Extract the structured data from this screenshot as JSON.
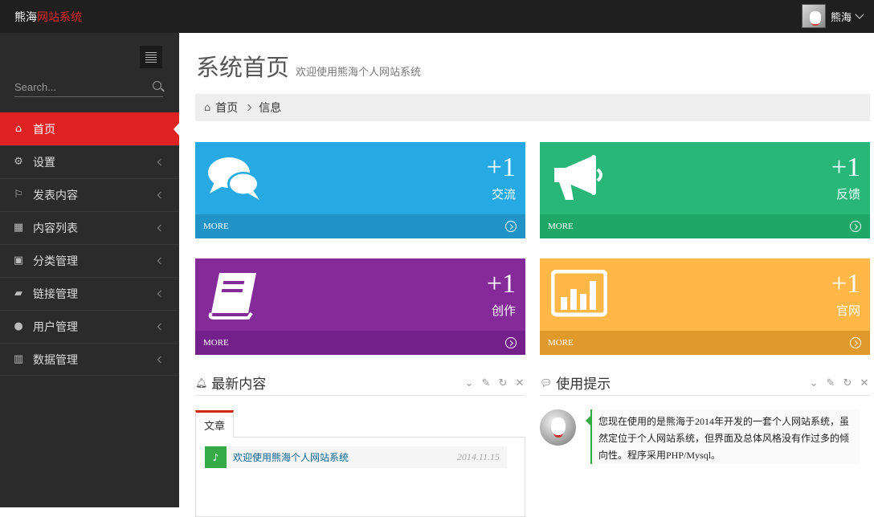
{
  "header": {
    "brand_part1": "熊海",
    "brand_part2": "网站系统",
    "user_name": "熊海"
  },
  "sidebar": {
    "search_placeholder": "Search...",
    "items": [
      {
        "label": "首页",
        "icon": "home-icon",
        "active": true
      },
      {
        "label": "设置",
        "icon": "cogs-icon"
      },
      {
        "label": "发表内容",
        "icon": "bookmark-icon"
      },
      {
        "label": "内容列表",
        "icon": "table-icon"
      },
      {
        "label": "分类管理",
        "icon": "gift-icon"
      },
      {
        "label": "链接管理",
        "icon": "folder-open-icon"
      },
      {
        "label": "用户管理",
        "icon": "user-icon"
      },
      {
        "label": "数据管理",
        "icon": "bar-chart-icon"
      }
    ]
  },
  "page": {
    "title": "系统首页",
    "subtitle": "欢迎使用熊海个人网站系统"
  },
  "breadcrumb": [
    "首页",
    "信息"
  ],
  "tiles": [
    {
      "count": "+1",
      "label": "交流",
      "more": "MORE",
      "icon": "comments-icon",
      "color": "#27a9e3"
    },
    {
      "count": "+1",
      "label": "反馈",
      "more": "MORE",
      "icon": "bullhorn-icon",
      "color": "#28b779"
    },
    {
      "count": "+1",
      "label": "创作",
      "more": "MORE",
      "icon": "book-icon",
      "color": "#852b99"
    },
    {
      "count": "+1",
      "label": "官网",
      "more": "MORE",
      "icon": "bar-chart-icon",
      "color": "#ffb848"
    }
  ],
  "latest": {
    "title": "最新内容",
    "tab": "文章",
    "items": [
      {
        "text": "欢迎使用熊海个人网站系统",
        "date": "2014.11.15"
      }
    ]
  },
  "tips": {
    "title": "使用提示",
    "message": "您现在使用的是熊海于2014年开发的一套个人网站系统，虽然定位于个人网站系统，但界面及总体风格没有作过多的倾向性。程序采用PHP/Mysql。"
  }
}
